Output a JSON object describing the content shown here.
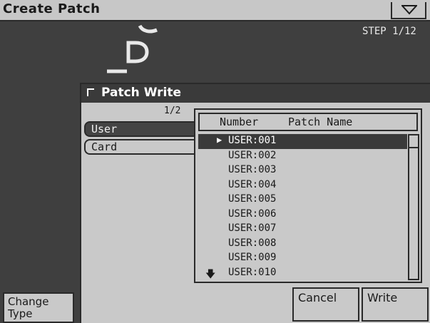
{
  "window": {
    "title": "Create Patch",
    "step": "STEP 1/12"
  },
  "soft_buttons": {
    "change_type": "Change\nType"
  },
  "dialog": {
    "title": "Patch Write",
    "page_indicator": "1/2",
    "tabs": [
      {
        "label": "User",
        "selected": true
      },
      {
        "label": "Card",
        "selected": false
      }
    ],
    "list": {
      "header_number": "Number",
      "header_name": "Patch Name",
      "items": [
        "USER:001",
        "USER:002",
        "USER:003",
        "USER:004",
        "USER:005",
        "USER:006",
        "USER:007",
        "USER:008",
        "USER:009",
        "USER:010"
      ],
      "selected_index": 0
    },
    "buttons": {
      "cancel": "Cancel",
      "write": "Write"
    }
  },
  "colors": {
    "dark": "#3a3a3a",
    "panel": "#c9c9c9",
    "background": "#3f3f3f"
  }
}
